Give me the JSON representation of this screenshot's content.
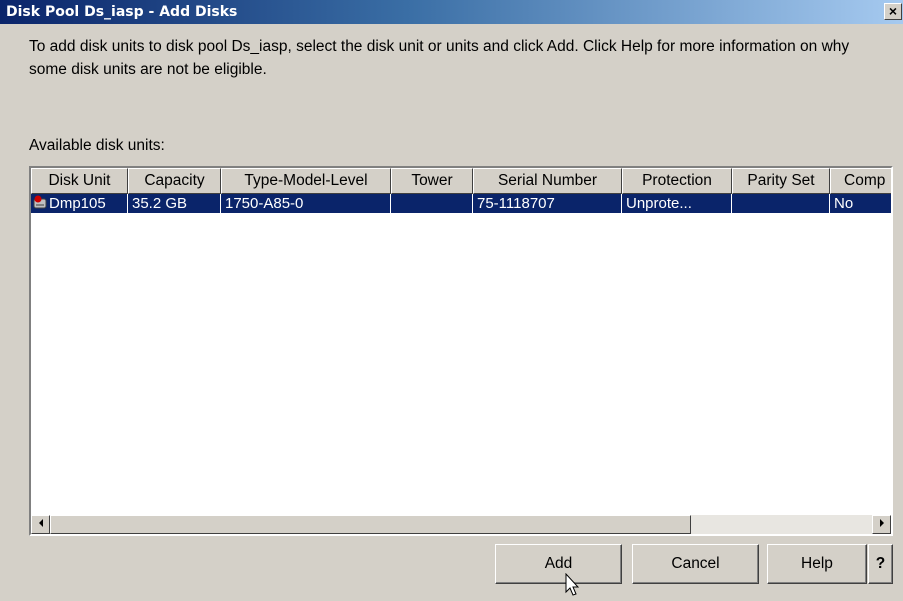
{
  "window": {
    "title": "Disk Pool Ds_iasp - Add Disks",
    "close_label": "×"
  },
  "instructions": "To add disk units to disk pool Ds_iasp, select the disk unit or units and click Add. Click Help for more information on why some disk units are not be eligible.",
  "available_label": "Available disk units:",
  "table": {
    "columns": [
      "Disk Unit",
      "Capacity",
      "Type-Model-Level",
      "Tower",
      "Serial Number",
      "Protection",
      "Parity Set",
      "Comp"
    ],
    "rows": [
      {
        "disk_unit": "Dmp105",
        "capacity": "35.2 GB",
        "type_model_level": "1750-A85-0",
        "tower": "",
        "serial_number": "75-1118707",
        "protection": "Unprote...",
        "parity_set": "",
        "comp": "No",
        "selected": true
      }
    ]
  },
  "scrollbar": {
    "left_icon": "scroll-left-icon",
    "right_icon": "scroll-right-icon"
  },
  "buttons": {
    "add": "Add",
    "cancel": "Cancel",
    "help": "Help",
    "whats_this": "?"
  },
  "colors": {
    "selection": "#0a246a",
    "face": "#d4d0c8",
    "title_start": "#0a246a",
    "title_end": "#a6caf0"
  }
}
